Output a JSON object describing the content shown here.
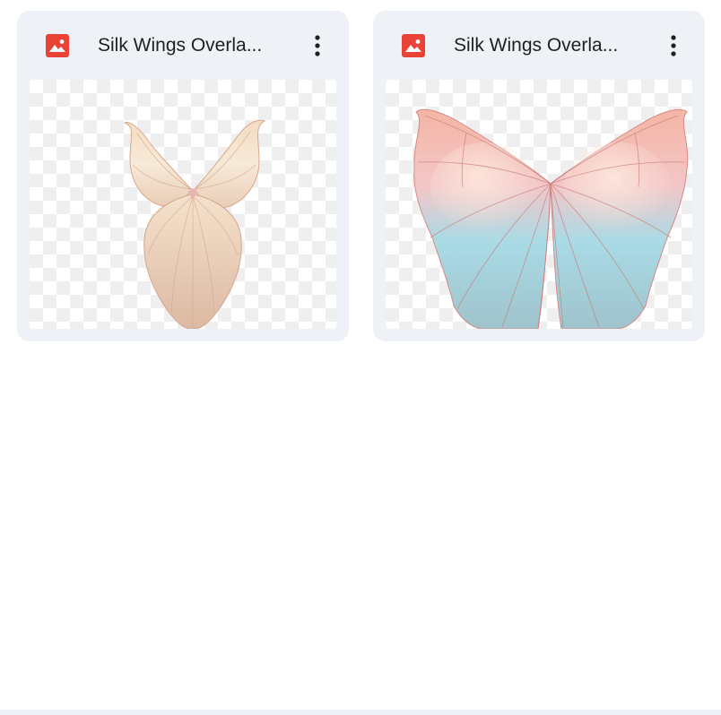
{
  "files": [
    {
      "title": "Silk Wings Overla...",
      "type_icon": "image-file-icon",
      "menu_icon": "more-vert-icon",
      "thumbnail": "cream-butterfly-wings"
    },
    {
      "title": "Silk Wings Overla...",
      "type_icon": "image-file-icon",
      "menu_icon": "more-vert-icon",
      "thumbnail": "pastel-pink-blue-wings"
    }
  ],
  "colors": {
    "card_background": "#eef1f6",
    "image_icon": "#ea4335",
    "title_text": "#1f1f1f",
    "checker": "#efefef"
  }
}
